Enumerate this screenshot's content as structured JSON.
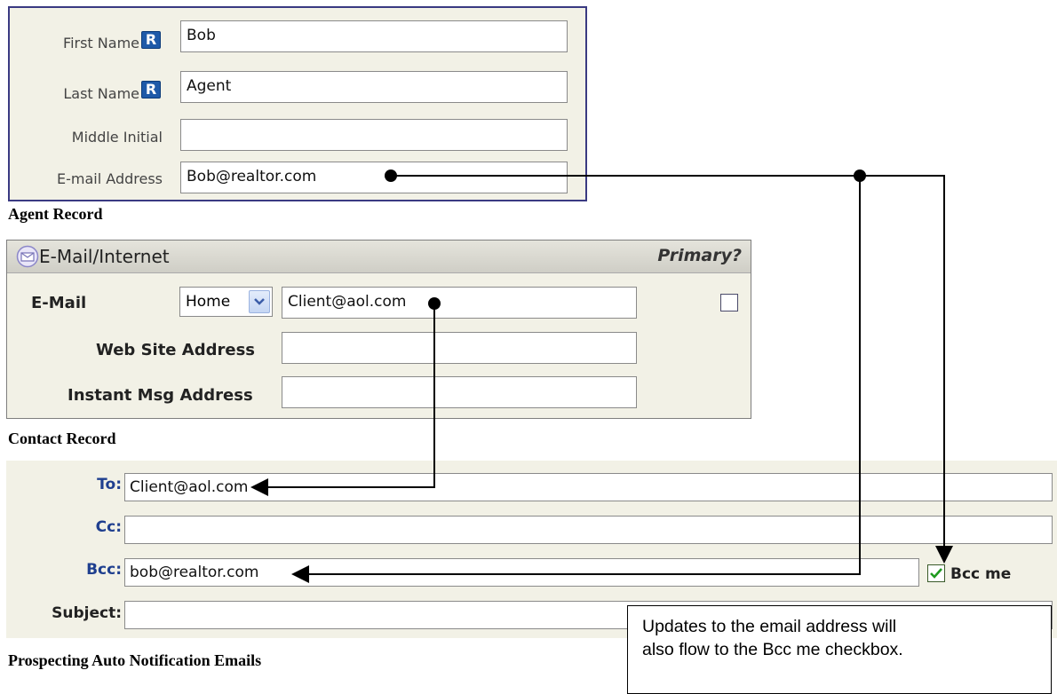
{
  "agent_panel": {
    "fields": [
      {
        "label": "First Name",
        "value": "Bob",
        "required_badge": "R"
      },
      {
        "label": "Last Name",
        "value": "Agent",
        "required_badge": "R"
      },
      {
        "label": "Middle Initial",
        "value": ""
      },
      {
        "label": "E-mail Address",
        "value": "Bob@realtor.com"
      }
    ],
    "caption": "Agent Record"
  },
  "contact_panel": {
    "title": "E-Mail/Internet",
    "primary_header": "Primary?",
    "email_label": "E-Mail",
    "email_type": "Home",
    "email_value": "Client@aol.com",
    "web_site_label": "Web Site Address",
    "web_site_value": "",
    "im_label": "Instant Msg Address",
    "im_value": "",
    "caption": "Contact Record"
  },
  "email_panel": {
    "to_label": "To:",
    "to_value": "Client@aol.com",
    "cc_label": "Cc:",
    "cc_value": "",
    "bcc_label": "Bcc:",
    "bcc_value": "bob@realtor.com",
    "bcc_me_label": "Bcc me",
    "bcc_me_checked": true,
    "subject_label": "Subject:",
    "subject_value": "",
    "caption": "Prospecting Auto Notification Emails"
  },
  "callout": {
    "line1": "Updates to the email address will",
    "line2": "also flow to the Bcc me checkbox."
  },
  "icons": {
    "envelope": "envelope-icon",
    "dropdown": "chevron-down-icon",
    "check": "checkmark-icon"
  },
  "colors": {
    "panel_bg": "#f2f1e6",
    "agent_border": "#3a3a82",
    "badge_blue": "#1e5aa8",
    "email_label_blue": "#1f3f8f"
  }
}
